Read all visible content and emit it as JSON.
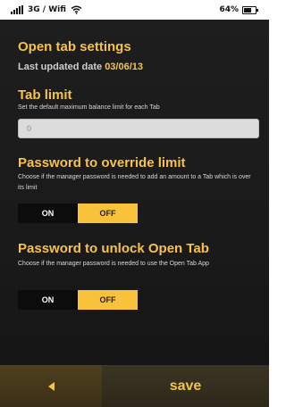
{
  "status_bar": {
    "network": "3G / Wifi",
    "battery": "64%",
    "signal_icon": "signal-icon",
    "wifi_icon": "wifi-icon",
    "battery_icon": "battery-icon"
  },
  "page": {
    "title": "Open tab settings",
    "updated_label": "Last updated date ",
    "updated_date": "03/06/13"
  },
  "tab_limit": {
    "heading": "Tab limit",
    "description": "Set the default maximum balance limit for each Tab",
    "value": "0"
  },
  "override_limit": {
    "heading": "Password to override limit",
    "description": "Choose if the manager password is needed to add an amount to a Tab which is over its limit",
    "on_label": "ON",
    "off_label": "OFF",
    "selected": "OFF"
  },
  "unlock_open_tab": {
    "heading": "Password to unlock Open Tab",
    "description": "Choose if the manager password is needed to use the Open Tab App",
    "on_label": "ON",
    "off_label": "OFF",
    "selected": "OFF"
  },
  "bottom_bar": {
    "back_icon": "back-arrow-icon",
    "save_label": "save"
  },
  "colors": {
    "accent": "#f5c347",
    "background": "#1a1a1a",
    "toggle_off": "#f8c23a",
    "toggle_on": "#0c0c0c"
  }
}
